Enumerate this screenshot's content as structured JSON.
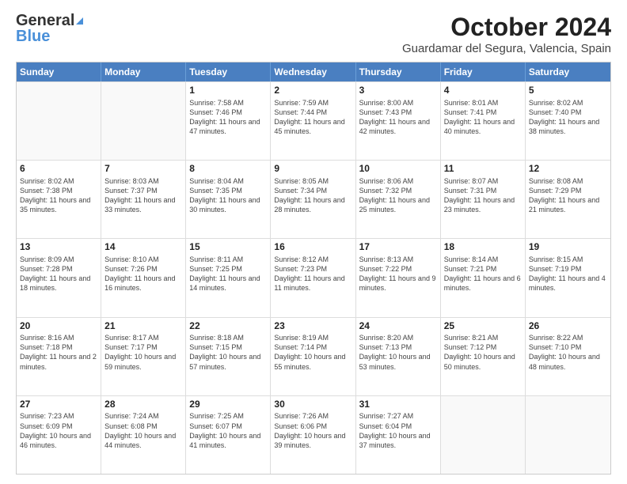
{
  "logo": {
    "general": "General",
    "blue": "Blue"
  },
  "header": {
    "title": "October 2024",
    "subtitle": "Guardamar del Segura, Valencia, Spain"
  },
  "weekdays": [
    "Sunday",
    "Monday",
    "Tuesday",
    "Wednesday",
    "Thursday",
    "Friday",
    "Saturday"
  ],
  "weeks": [
    [
      {
        "day": "",
        "sunrise": "",
        "sunset": "",
        "daylight": ""
      },
      {
        "day": "",
        "sunrise": "",
        "sunset": "",
        "daylight": ""
      },
      {
        "day": "1",
        "sunrise": "Sunrise: 7:58 AM",
        "sunset": "Sunset: 7:46 PM",
        "daylight": "Daylight: 11 hours and 47 minutes."
      },
      {
        "day": "2",
        "sunrise": "Sunrise: 7:59 AM",
        "sunset": "Sunset: 7:44 PM",
        "daylight": "Daylight: 11 hours and 45 minutes."
      },
      {
        "day": "3",
        "sunrise": "Sunrise: 8:00 AM",
        "sunset": "Sunset: 7:43 PM",
        "daylight": "Daylight: 11 hours and 42 minutes."
      },
      {
        "day": "4",
        "sunrise": "Sunrise: 8:01 AM",
        "sunset": "Sunset: 7:41 PM",
        "daylight": "Daylight: 11 hours and 40 minutes."
      },
      {
        "day": "5",
        "sunrise": "Sunrise: 8:02 AM",
        "sunset": "Sunset: 7:40 PM",
        "daylight": "Daylight: 11 hours and 38 minutes."
      }
    ],
    [
      {
        "day": "6",
        "sunrise": "Sunrise: 8:02 AM",
        "sunset": "Sunset: 7:38 PM",
        "daylight": "Daylight: 11 hours and 35 minutes."
      },
      {
        "day": "7",
        "sunrise": "Sunrise: 8:03 AM",
        "sunset": "Sunset: 7:37 PM",
        "daylight": "Daylight: 11 hours and 33 minutes."
      },
      {
        "day": "8",
        "sunrise": "Sunrise: 8:04 AM",
        "sunset": "Sunset: 7:35 PM",
        "daylight": "Daylight: 11 hours and 30 minutes."
      },
      {
        "day": "9",
        "sunrise": "Sunrise: 8:05 AM",
        "sunset": "Sunset: 7:34 PM",
        "daylight": "Daylight: 11 hours and 28 minutes."
      },
      {
        "day": "10",
        "sunrise": "Sunrise: 8:06 AM",
        "sunset": "Sunset: 7:32 PM",
        "daylight": "Daylight: 11 hours and 25 minutes."
      },
      {
        "day": "11",
        "sunrise": "Sunrise: 8:07 AM",
        "sunset": "Sunset: 7:31 PM",
        "daylight": "Daylight: 11 hours and 23 minutes."
      },
      {
        "day": "12",
        "sunrise": "Sunrise: 8:08 AM",
        "sunset": "Sunset: 7:29 PM",
        "daylight": "Daylight: 11 hours and 21 minutes."
      }
    ],
    [
      {
        "day": "13",
        "sunrise": "Sunrise: 8:09 AM",
        "sunset": "Sunset: 7:28 PM",
        "daylight": "Daylight: 11 hours and 18 minutes."
      },
      {
        "day": "14",
        "sunrise": "Sunrise: 8:10 AM",
        "sunset": "Sunset: 7:26 PM",
        "daylight": "Daylight: 11 hours and 16 minutes."
      },
      {
        "day": "15",
        "sunrise": "Sunrise: 8:11 AM",
        "sunset": "Sunset: 7:25 PM",
        "daylight": "Daylight: 11 hours and 14 minutes."
      },
      {
        "day": "16",
        "sunrise": "Sunrise: 8:12 AM",
        "sunset": "Sunset: 7:23 PM",
        "daylight": "Daylight: 11 hours and 11 minutes."
      },
      {
        "day": "17",
        "sunrise": "Sunrise: 8:13 AM",
        "sunset": "Sunset: 7:22 PM",
        "daylight": "Daylight: 11 hours and 9 minutes."
      },
      {
        "day": "18",
        "sunrise": "Sunrise: 8:14 AM",
        "sunset": "Sunset: 7:21 PM",
        "daylight": "Daylight: 11 hours and 6 minutes."
      },
      {
        "day": "19",
        "sunrise": "Sunrise: 8:15 AM",
        "sunset": "Sunset: 7:19 PM",
        "daylight": "Daylight: 11 hours and 4 minutes."
      }
    ],
    [
      {
        "day": "20",
        "sunrise": "Sunrise: 8:16 AM",
        "sunset": "Sunset: 7:18 PM",
        "daylight": "Daylight: 11 hours and 2 minutes."
      },
      {
        "day": "21",
        "sunrise": "Sunrise: 8:17 AM",
        "sunset": "Sunset: 7:17 PM",
        "daylight": "Daylight: 10 hours and 59 minutes."
      },
      {
        "day": "22",
        "sunrise": "Sunrise: 8:18 AM",
        "sunset": "Sunset: 7:15 PM",
        "daylight": "Daylight: 10 hours and 57 minutes."
      },
      {
        "day": "23",
        "sunrise": "Sunrise: 8:19 AM",
        "sunset": "Sunset: 7:14 PM",
        "daylight": "Daylight: 10 hours and 55 minutes."
      },
      {
        "day": "24",
        "sunrise": "Sunrise: 8:20 AM",
        "sunset": "Sunset: 7:13 PM",
        "daylight": "Daylight: 10 hours and 53 minutes."
      },
      {
        "day": "25",
        "sunrise": "Sunrise: 8:21 AM",
        "sunset": "Sunset: 7:12 PM",
        "daylight": "Daylight: 10 hours and 50 minutes."
      },
      {
        "day": "26",
        "sunrise": "Sunrise: 8:22 AM",
        "sunset": "Sunset: 7:10 PM",
        "daylight": "Daylight: 10 hours and 48 minutes."
      }
    ],
    [
      {
        "day": "27",
        "sunrise": "Sunrise: 7:23 AM",
        "sunset": "Sunset: 6:09 PM",
        "daylight": "Daylight: 10 hours and 46 minutes."
      },
      {
        "day": "28",
        "sunrise": "Sunrise: 7:24 AM",
        "sunset": "Sunset: 6:08 PM",
        "daylight": "Daylight: 10 hours and 44 minutes."
      },
      {
        "day": "29",
        "sunrise": "Sunrise: 7:25 AM",
        "sunset": "Sunset: 6:07 PM",
        "daylight": "Daylight: 10 hours and 41 minutes."
      },
      {
        "day": "30",
        "sunrise": "Sunrise: 7:26 AM",
        "sunset": "Sunset: 6:06 PM",
        "daylight": "Daylight: 10 hours and 39 minutes."
      },
      {
        "day": "31",
        "sunrise": "Sunrise: 7:27 AM",
        "sunset": "Sunset: 6:04 PM",
        "daylight": "Daylight: 10 hours and 37 minutes."
      },
      {
        "day": "",
        "sunrise": "",
        "sunset": "",
        "daylight": ""
      },
      {
        "day": "",
        "sunrise": "",
        "sunset": "",
        "daylight": ""
      }
    ]
  ]
}
